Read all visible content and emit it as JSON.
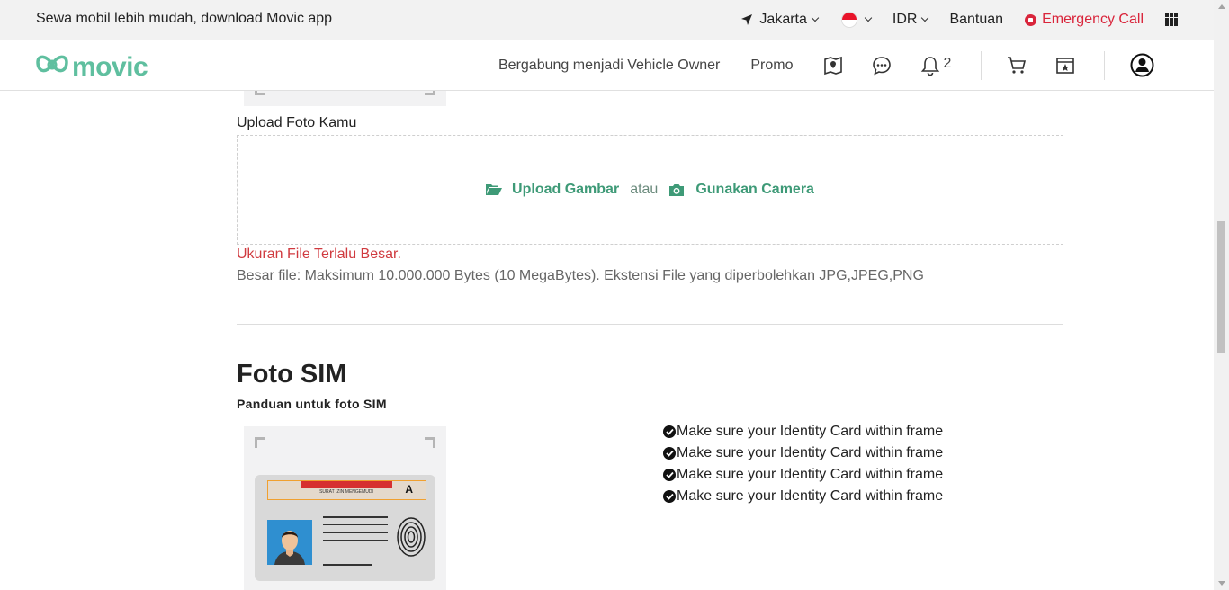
{
  "topbar": {
    "promo_text": "Sewa mobil lebih mudah, download Movic app",
    "location": "Jakarta",
    "currency": "IDR",
    "help": "Bantuan",
    "emergency": "Emergency Call"
  },
  "navbar": {
    "logo_text": "movic",
    "join_owner": "Bergabung menjadi Vehicle Owner",
    "promo": "Promo",
    "notification_count": "2"
  },
  "upload": {
    "label": "Upload Foto Kamu",
    "upload_image": "Upload Gambar",
    "or": "atau",
    "use_camera": "Gunakan Camera",
    "error": "Ukuran File Terlalu Besar.",
    "hint": "Besar file: Maksimum 10.000.000 Bytes (10 MegaBytes). Ekstensi File yang diperbolehkan JPG,JPEG,PNG"
  },
  "sim_section": {
    "title": "Foto SIM",
    "subtitle": "Panduan untuk foto SIM",
    "card_header": "SURAT IZIN MENGEMUDI",
    "card_class": "A",
    "tips": [
      "Make sure your Identity Card within frame",
      "Make sure your Identity Card within frame",
      "Make sure your Identity Card within frame",
      "Make sure your Identity Card within frame"
    ]
  },
  "colors": {
    "brand": "#5fbf9f",
    "action": "#3e9a77",
    "error": "#d03a3f",
    "emergency": "#d9253b"
  }
}
